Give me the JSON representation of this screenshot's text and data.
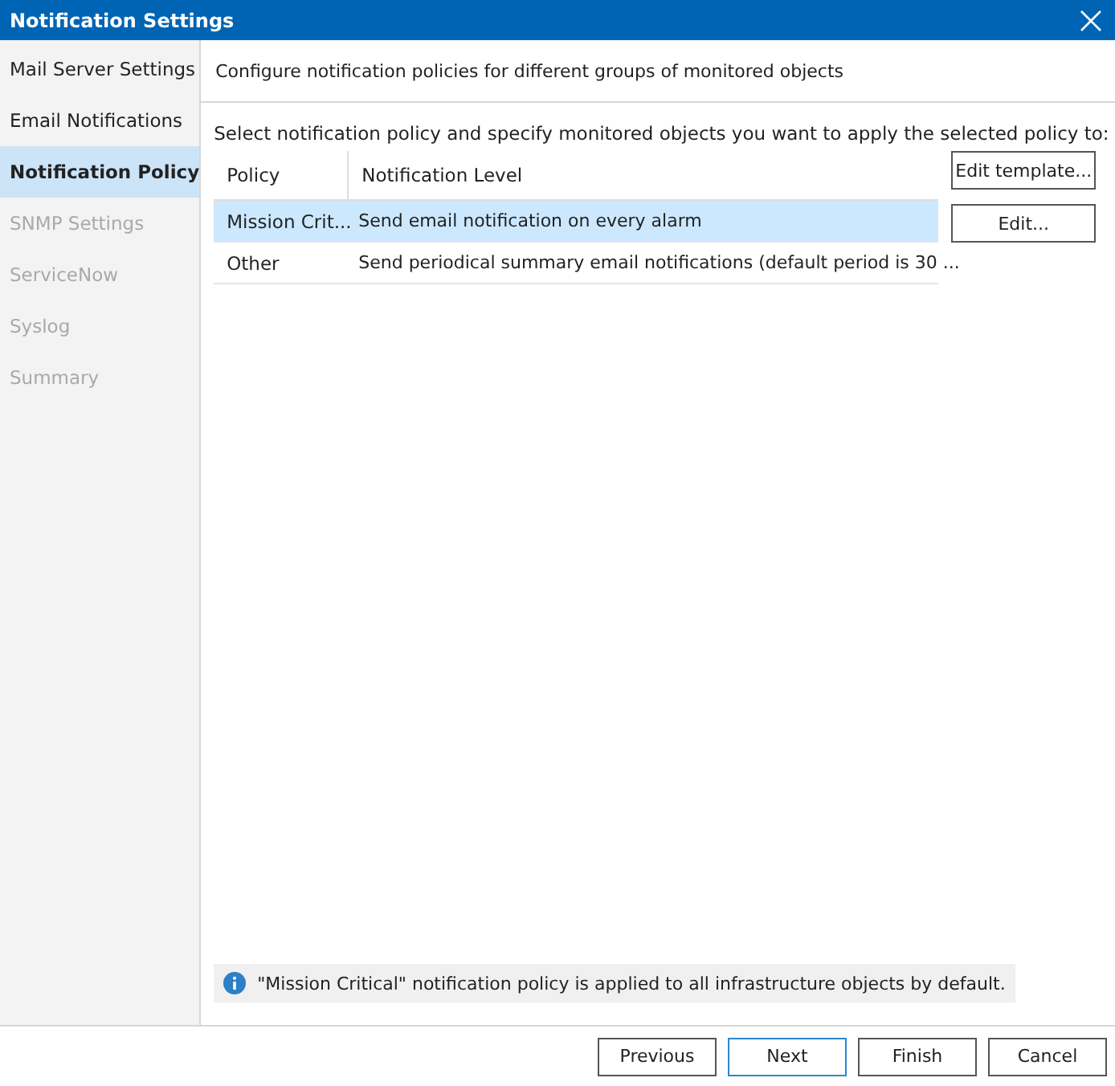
{
  "window": {
    "title": "Notification Settings"
  },
  "sidebar": {
    "items": [
      {
        "label": "Mail Server Settings",
        "selected": false,
        "disabled": false
      },
      {
        "label": "Email Notifications",
        "selected": false,
        "disabled": false
      },
      {
        "label": "Notification Policy",
        "selected": true,
        "disabled": false
      },
      {
        "label": "SNMP Settings",
        "selected": false,
        "disabled": true
      },
      {
        "label": "ServiceNow",
        "selected": false,
        "disabled": true
      },
      {
        "label": "Syslog",
        "selected": false,
        "disabled": true
      },
      {
        "label": "Summary",
        "selected": false,
        "disabled": true
      }
    ]
  },
  "header": "Configure notification policies for different groups of monitored objects",
  "instruction": "Select notification policy and specify monitored objects you want to apply the selected policy to:",
  "table": {
    "columns": [
      "Policy",
      "Notification Level"
    ],
    "rows": [
      {
        "cells": [
          "Mission Crit...",
          "Send email notification on every alarm"
        ],
        "selected": true
      },
      {
        "cells": [
          "Other",
          "Send periodical summary email notifications (default period is 30 ..."
        ],
        "selected": false
      }
    ]
  },
  "side_buttons": [
    "Edit template...",
    "Edit..."
  ],
  "info": "\"Mission Critical\" notification policy is applied to all infrastructure objects by default.",
  "buttons": [
    {
      "label": "Previous",
      "default": false
    },
    {
      "label": "Next",
      "default": true
    },
    {
      "label": "Finish",
      "default": false
    },
    {
      "label": "Cancel",
      "default": false
    }
  ]
}
